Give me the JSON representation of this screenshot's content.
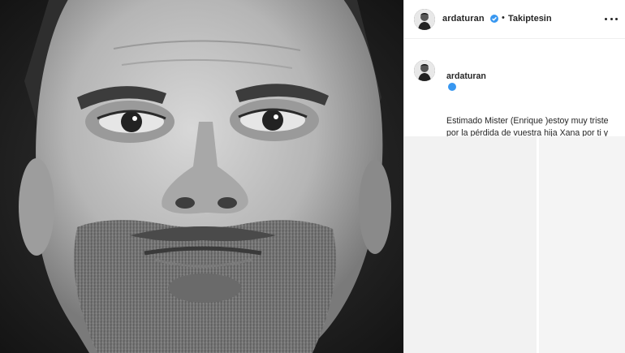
{
  "post": {
    "photo": {
      "description_icon": "portrait-photo"
    },
    "header": {
      "username": "ardaturan",
      "verified_icon": "verified-badge-icon",
      "separator": "•",
      "follow_state": "Takiptesin",
      "more_icon": "more-options-icon"
    },
    "caption": {
      "username": "ardaturan",
      "verified_icon": "verified-badge-icon",
      "text": "Estimado Mister (Enrique )estoy muy triste por la pérdida de vuestra hija Xana por ti y por tu familia y comparto vuestro dolor con todo mi corazón"
    },
    "colors": {
      "verified": "#3897f0",
      "text": "#262626",
      "border": "#efefef"
    }
  }
}
